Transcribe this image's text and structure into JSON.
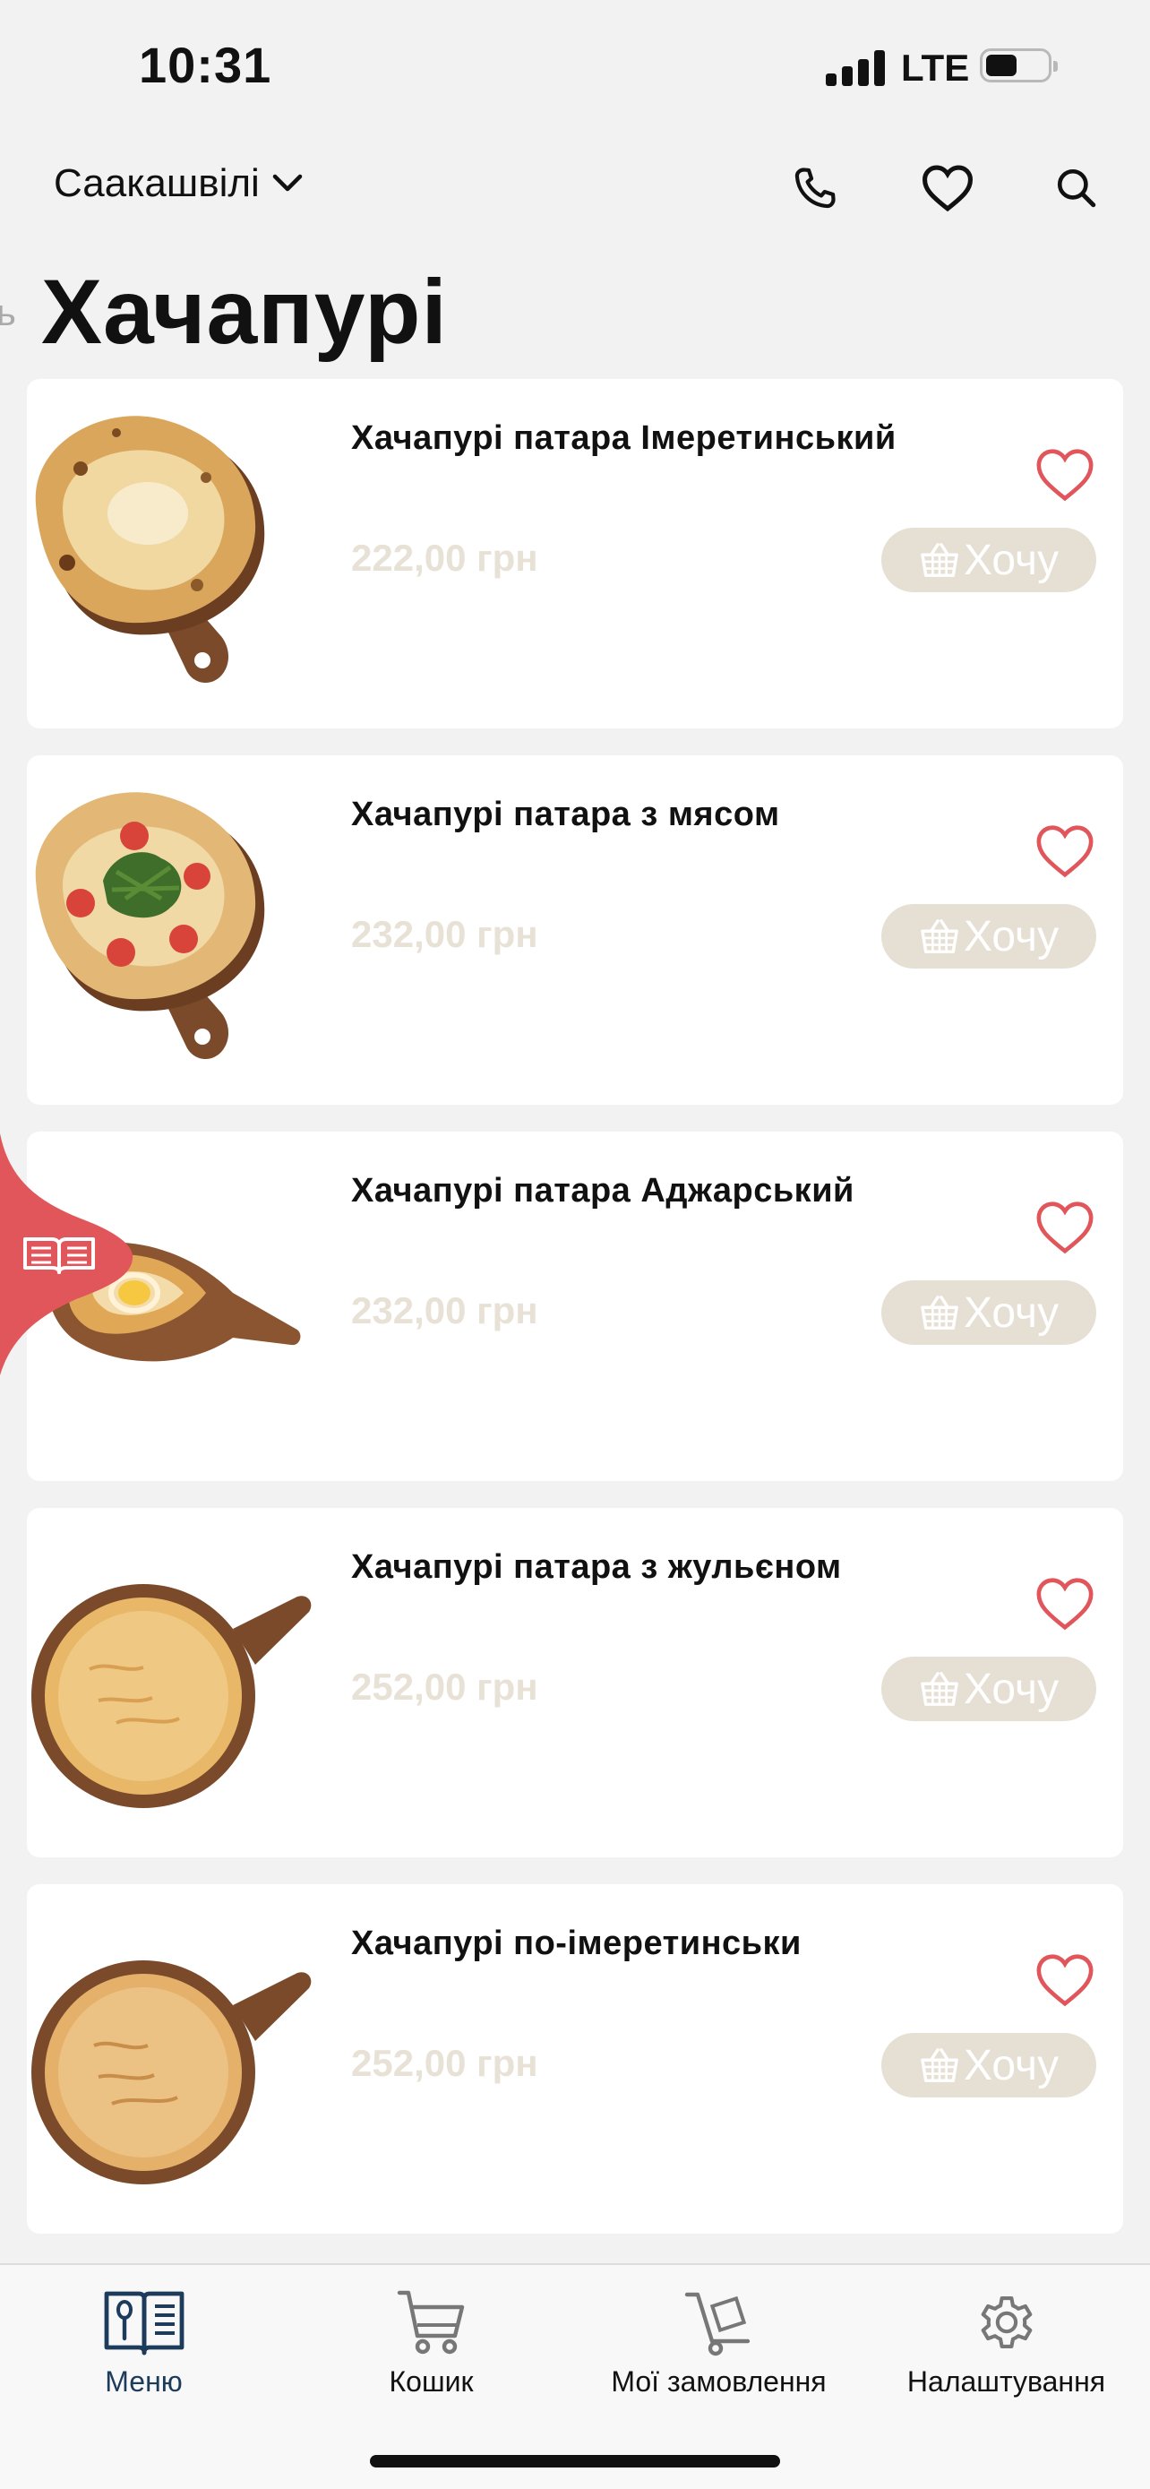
{
  "status_bar": {
    "time": "10:31",
    "network": "LTE"
  },
  "header": {
    "city": "Саакашвілі",
    "icons": [
      "phone-icon",
      "heart-icon",
      "search-icon"
    ]
  },
  "page": {
    "title": "Хачапурі"
  },
  "products": [
    {
      "name": "Хачапурі патара Імеретинський",
      "price": "222,00 грн",
      "button": "Хочу"
    },
    {
      "name": "Хачапурі патара з мясом",
      "price": "232,00 грн",
      "button": "Хочу"
    },
    {
      "name": "Хачапурі патара Аджарський",
      "price": "232,00 грн",
      "button": "Хочу"
    },
    {
      "name": "Хачапурі патара з жульєном",
      "price": "252,00 грн",
      "button": "Хочу"
    },
    {
      "name": "Хачапурі по-імеретинськи",
      "price": "252,00 грн",
      "button": "Хочу"
    }
  ],
  "tabs": [
    {
      "label": "Меню",
      "icon": "menu-book-icon",
      "active": true
    },
    {
      "label": "Кошик",
      "icon": "cart-icon",
      "active": false
    },
    {
      "label": "Мої замовлення",
      "icon": "hand-truck-icon",
      "active": false
    },
    {
      "label": "Налаштування",
      "icon": "gear-icon",
      "active": false
    }
  ],
  "colors": {
    "accent": "#e0565b",
    "price": "#e8e1d6",
    "button_bg": "#e6dfd4",
    "tab_active": "#1d3b5a"
  }
}
